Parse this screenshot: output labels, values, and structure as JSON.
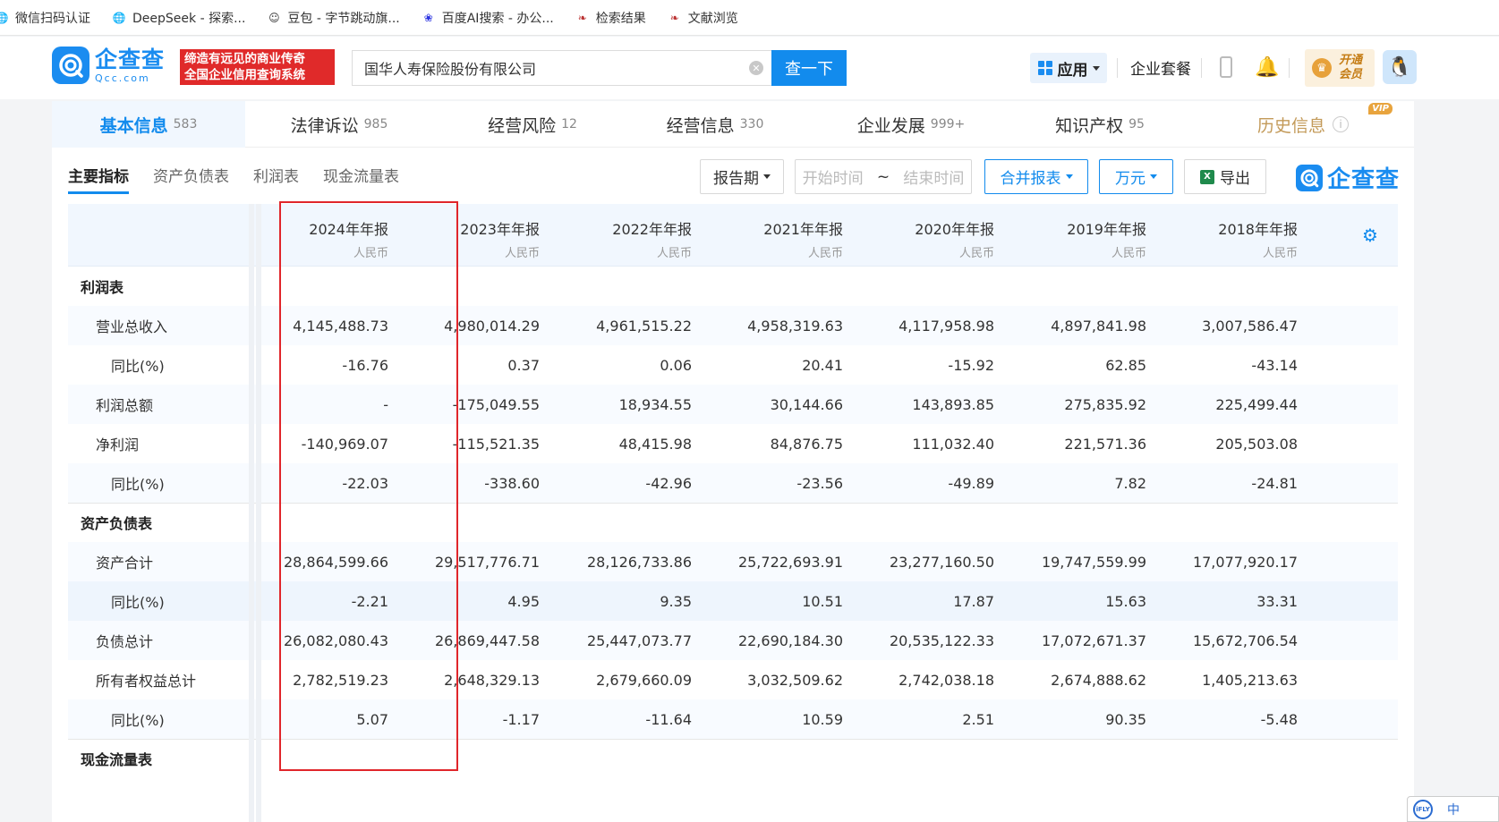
{
  "bookmarks": [
    {
      "label": "微信扫码认证",
      "icon": "globe-icon"
    },
    {
      "label": "DeepSeek - 探索...",
      "icon": "globe-icon"
    },
    {
      "label": "豆包 - 字节跳动旗...",
      "icon": "doubao-icon"
    },
    {
      "label": "百度AI搜索 - 办公...",
      "icon": "baidu-icon"
    },
    {
      "label": "检索结果",
      "icon": "cnki-icon"
    },
    {
      "label": "文献浏览",
      "icon": "cnki-icon"
    }
  ],
  "header": {
    "logo_main": "企查查",
    "logo_sub": "Qcc.com",
    "slogan_line1": "缔造有远见的商业传奇",
    "slogan_line2": "全国企业信用查询系统",
    "search_value": "国华人寿保险股份有限公司",
    "search_button": "查一下",
    "apps_label": "应用",
    "suite_label": "企业套餐",
    "vip_line1": "开通",
    "vip_line2": "会员"
  },
  "tabs": [
    {
      "label": "基本信息",
      "count": "583"
    },
    {
      "label": "法律诉讼",
      "count": "985"
    },
    {
      "label": "经营风险",
      "count": "12"
    },
    {
      "label": "经营信息",
      "count": "330"
    },
    {
      "label": "企业发展",
      "count": "999+"
    },
    {
      "label": "知识产权",
      "count": "95"
    },
    {
      "label": "历史信息",
      "count": "",
      "badge": "VIP"
    }
  ],
  "subtabs": [
    "主要指标",
    "资产负债表",
    "利润表",
    "现金流量表"
  ],
  "controls": {
    "period": "报告期",
    "start_placeholder": "开始时间",
    "range_sep": "~",
    "end_placeholder": "结束时间",
    "consolidated": "合并报表",
    "unit": "万元",
    "export": "导出",
    "brand": "企查查"
  },
  "table": {
    "columns": [
      {
        "year": "2024年年报",
        "currency": "人民币"
      },
      {
        "year": "2023年年报",
        "currency": "人民币"
      },
      {
        "year": "2022年年报",
        "currency": "人民币"
      },
      {
        "year": "2021年年报",
        "currency": "人民币"
      },
      {
        "year": "2020年年报",
        "currency": "人民币"
      },
      {
        "year": "2019年年报",
        "currency": "人民币"
      },
      {
        "year": "2018年年报",
        "currency": "人民币"
      }
    ],
    "rows": [
      {
        "label": "利润表",
        "level": 0,
        "values": []
      },
      {
        "label": "营业总收入",
        "level": 1,
        "values": [
          "4,145,488.73",
          "4,980,014.29",
          "4,961,515.22",
          "4,958,319.63",
          "4,117,958.98",
          "4,897,841.98",
          "3,007,586.47"
        ]
      },
      {
        "label": "同比(%)",
        "level": 2,
        "values": [
          "-16.76",
          "0.37",
          "0.06",
          "20.41",
          "-15.92",
          "62.85",
          "-43.14"
        ]
      },
      {
        "label": "利润总额",
        "level": 1,
        "values": [
          "-",
          "-175,049.55",
          "18,934.55",
          "30,144.66",
          "143,893.85",
          "275,835.92",
          "225,499.44"
        ]
      },
      {
        "label": "净利润",
        "level": 1,
        "values": [
          "-140,969.07",
          "-115,521.35",
          "48,415.98",
          "84,876.75",
          "111,032.40",
          "221,571.36",
          "205,503.08"
        ]
      },
      {
        "label": "同比(%)",
        "level": 2,
        "values": [
          "-22.03",
          "-338.60",
          "-42.96",
          "-23.56",
          "-49.89",
          "7.82",
          "-24.81"
        ]
      },
      {
        "label": "资产负债表",
        "level": 0,
        "values": []
      },
      {
        "label": "资产合计",
        "level": 1,
        "values": [
          "28,864,599.66",
          "29,517,776.71",
          "28,126,733.86",
          "25,722,693.91",
          "23,277,160.50",
          "19,747,559.99",
          "17,077,920.17"
        ]
      },
      {
        "label": "同比(%)",
        "level": 2,
        "values": [
          "-2.21",
          "4.95",
          "9.35",
          "10.51",
          "17.87",
          "15.63",
          "33.31"
        ]
      },
      {
        "label": "负债总计",
        "level": 1,
        "values": [
          "26,082,080.43",
          "26,869,447.58",
          "25,447,073.77",
          "22,690,184.30",
          "20,535,122.33",
          "17,072,671.37",
          "15,672,706.54"
        ]
      },
      {
        "label": "所有者权益总计",
        "level": 1,
        "values": [
          "2,782,519.23",
          "2,648,329.13",
          "2,679,660.09",
          "3,032,509.62",
          "2,742,038.18",
          "2,674,888.62",
          "1,405,213.63"
        ]
      },
      {
        "label": "同比(%)",
        "level": 2,
        "values": [
          "5.07",
          "-1.17",
          "-11.64",
          "10.59",
          "2.51",
          "90.35",
          "-5.48"
        ]
      },
      {
        "label": "现金流量表",
        "level": 0,
        "values": []
      }
    ]
  },
  "corner_widget": {
    "logo": "iFLY",
    "label": "中"
  },
  "colors": {
    "accent": "#128bed",
    "highlight_box": "#e0262b",
    "vip_gold": "#c39a59"
  }
}
